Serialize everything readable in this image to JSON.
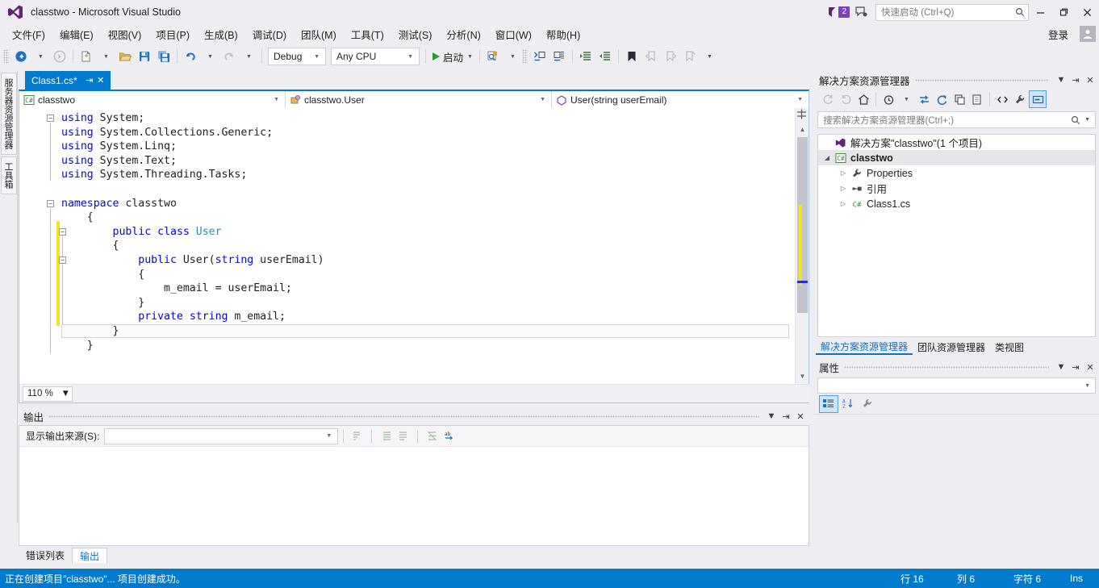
{
  "window": {
    "title": "classtwo - Microsoft Visual Studio",
    "logo_icon": "visual-studio-logo-icon",
    "notification_count": "2",
    "feedback_icon": "feedback-icon",
    "minimize_icon": "minimize-icon",
    "maximize_icon": "maximize-icon",
    "close_icon": "close-icon",
    "sign_in_label": "登录",
    "avatar_icon": "user-avatar-icon"
  },
  "quick_launch": {
    "placeholder": "快速启动 (Ctrl+Q)",
    "search_icon": "search-icon"
  },
  "menu": {
    "items": [
      {
        "label": "文件(F)"
      },
      {
        "label": "编辑(E)"
      },
      {
        "label": "视图(V)"
      },
      {
        "label": "项目(P)"
      },
      {
        "label": "生成(B)"
      },
      {
        "label": "调试(D)"
      },
      {
        "label": "团队(M)"
      },
      {
        "label": "工具(T)"
      },
      {
        "label": "测试(S)"
      },
      {
        "label": "分析(N)"
      },
      {
        "label": "窗口(W)"
      },
      {
        "label": "帮助(H)"
      }
    ]
  },
  "toolbar": {
    "navigate_back_icon": "navigate-back-icon",
    "navigate_forward_icon": "navigate-forward-icon",
    "new_project_icon": "new-project-icon",
    "open_file_icon": "open-file-icon",
    "save_icon": "save-icon",
    "save_all_icon": "save-all-icon",
    "undo_icon": "undo-icon",
    "redo_icon": "redo-icon",
    "config_value": "Debug",
    "platform_value": "Any CPU",
    "start_label": "启动",
    "start_icon": "play-icon",
    "find_icon": "find-in-files-icon",
    "comment_icon": "comment-selection-icon",
    "uncomment_icon": "uncomment-selection-icon",
    "indent_icon": "increase-indent-icon",
    "outdent_icon": "decrease-indent-icon",
    "bookmark_icon": "bookmark-icon",
    "prev_bookmark_icon": "previous-bookmark-icon",
    "next_bookmark_icon": "next-bookmark-icon",
    "clear_bookmarks_icon": "clear-bookmarks-icon",
    "overflow_icon": "toolbar-overflow-icon"
  },
  "autohide_tabs": [
    {
      "label": "服务器资源管理器",
      "icon": "server-explorer-icon"
    },
    {
      "label": "工具箱",
      "icon": "toolbox-icon"
    }
  ],
  "editor": {
    "tab": {
      "label": "Class1.cs*",
      "pin_icon": "pin-icon",
      "close_icon": "close-icon"
    },
    "nav_project": {
      "value": "classtwo",
      "icon": "csharp-file-icon"
    },
    "nav_type": {
      "value": "classtwo.User",
      "icon": "class-icon"
    },
    "nav_member": {
      "value": "User(string userEmail)",
      "icon": "method-icon"
    },
    "zoom_level": "110 %",
    "split_icon": "split-view-icon",
    "scroll_up_icon": "scroll-up-icon",
    "scroll_down_icon": "scroll-down-icon",
    "code_lines": [
      {
        "indent": 0,
        "tokens": [
          {
            "t": "using",
            "c": "k"
          },
          {
            "t": " System;",
            "c": ""
          }
        ]
      },
      {
        "indent": 0,
        "tokens": [
          {
            "t": "using",
            "c": "k"
          },
          {
            "t": " System.Collections.Generic;",
            "c": ""
          }
        ]
      },
      {
        "indent": 0,
        "tokens": [
          {
            "t": "using",
            "c": "k"
          },
          {
            "t": " System.Linq;",
            "c": ""
          }
        ]
      },
      {
        "indent": 0,
        "tokens": [
          {
            "t": "using",
            "c": "k"
          },
          {
            "t": " System.Text;",
            "c": ""
          }
        ]
      },
      {
        "indent": 0,
        "tokens": [
          {
            "t": "using",
            "c": "k"
          },
          {
            "t": " System.Threading.Tasks;",
            "c": ""
          }
        ]
      },
      {
        "indent": 0,
        "tokens": []
      },
      {
        "indent": 0,
        "tokens": [
          {
            "t": "namespace",
            "c": "k"
          },
          {
            "t": " classtwo",
            "c": ""
          }
        ]
      },
      {
        "indent": 1,
        "tokens": [
          {
            "t": "{",
            "c": ""
          }
        ]
      },
      {
        "indent": 2,
        "tokens": [
          {
            "t": "public",
            "c": "k"
          },
          {
            "t": " ",
            "c": ""
          },
          {
            "t": "class",
            "c": "k"
          },
          {
            "t": " ",
            "c": ""
          },
          {
            "t": "User",
            "c": "t"
          }
        ]
      },
      {
        "indent": 2,
        "tokens": [
          {
            "t": "{",
            "c": ""
          }
        ]
      },
      {
        "indent": 3,
        "tokens": [
          {
            "t": "public",
            "c": "k"
          },
          {
            "t": " User(",
            "c": ""
          },
          {
            "t": "string",
            "c": "k"
          },
          {
            "t": " userEmail)",
            "c": ""
          }
        ]
      },
      {
        "indent": 3,
        "tokens": [
          {
            "t": "{",
            "c": ""
          }
        ]
      },
      {
        "indent": 4,
        "tokens": [
          {
            "t": "m_email = userEmail;",
            "c": ""
          }
        ]
      },
      {
        "indent": 3,
        "tokens": [
          {
            "t": "}",
            "c": ""
          }
        ]
      },
      {
        "indent": 3,
        "tokens": [
          {
            "t": "private",
            "c": "k"
          },
          {
            "t": " ",
            "c": ""
          },
          {
            "t": "string",
            "c": "k"
          },
          {
            "t": " m_email;",
            "c": ""
          }
        ]
      },
      {
        "indent": 2,
        "tokens": [
          {
            "t": "}",
            "c": ""
          }
        ]
      },
      {
        "indent": 1,
        "tokens": [
          {
            "t": "}",
            "c": ""
          }
        ]
      }
    ]
  },
  "output_panel": {
    "title": "输出",
    "dropdown_icon": "chevron-down-icon",
    "pin_icon": "pin-icon",
    "close_icon": "close-icon",
    "source_label": "显示输出来源(S):",
    "source_value": "",
    "content": "",
    "icons": [
      {
        "name": "find-message-icon"
      },
      {
        "name": "clear-all-icon"
      },
      {
        "name": "toggle-word-wrap-icon"
      },
      {
        "name": "go-to-message-icon"
      },
      {
        "name": "toggle-autoscroll-icon"
      }
    ]
  },
  "bottom_tabs": [
    {
      "label": "错误列表",
      "active": false
    },
    {
      "label": "输出",
      "active": true
    }
  ],
  "solution_explorer": {
    "title": "解决方案资源管理器",
    "dropdown_icon": "chevron-down-icon",
    "pin_icon": "pin-icon",
    "close_icon": "close-icon",
    "search_placeholder": "搜索解决方案资源管理器(Ctrl+;)",
    "search_icon": "search-icon",
    "search_dropdown_icon": "chevron-down-icon",
    "toolbar_icons": [
      {
        "name": "back-icon",
        "state": "dim"
      },
      {
        "name": "forward-icon",
        "state": "dim"
      },
      {
        "name": "home-icon",
        "state": "normal"
      },
      {
        "name": "pending-changes-icon",
        "state": "normal"
      },
      {
        "name": "sync-with-active-document-icon",
        "state": "normal"
      },
      {
        "name": "refresh-icon",
        "state": "normal"
      },
      {
        "name": "collapse-all-icon",
        "state": "normal"
      },
      {
        "name": "show-all-files-icon",
        "state": "normal"
      },
      {
        "name": "view-code-icon",
        "state": "normal"
      },
      {
        "name": "properties-icon",
        "state": "normal"
      },
      {
        "name": "preview-selected-items-icon",
        "state": "selected"
      }
    ],
    "tree": [
      {
        "label": "解决方案\"classtwo\"(1 个项目)",
        "icon": "solution-icon",
        "depth": 0,
        "expander": "",
        "bold": false,
        "selected": false
      },
      {
        "label": "classtwo",
        "icon": "csharp-project-icon",
        "depth": 0,
        "expander": "expanded",
        "bold": true,
        "selected": true
      },
      {
        "label": "Properties",
        "icon": "properties-folder-icon",
        "depth": 1,
        "expander": "collapsed",
        "bold": false,
        "selected": false
      },
      {
        "label": "引用",
        "icon": "references-icon",
        "depth": 1,
        "expander": "collapsed",
        "bold": false,
        "selected": false
      },
      {
        "label": "Class1.cs",
        "icon": "csharp-file-icon",
        "depth": 1,
        "expander": "collapsed",
        "bold": false,
        "selected": false
      }
    ],
    "tabs": [
      {
        "label": "解决方案资源管理器",
        "active": true
      },
      {
        "label": "团队资源管理器",
        "active": false
      },
      {
        "label": "类视图",
        "active": false
      }
    ]
  },
  "properties_panel": {
    "title": "属性",
    "dropdown_icon": "chevron-down-icon",
    "pin_icon": "pin-icon",
    "close_icon": "close-icon",
    "object_value": "",
    "object_dropdown_icon": "chevron-down-icon",
    "categorized_icon": "categorized-view-icon",
    "alphabetical_icon": "alphabetical-sort-icon",
    "property_pages_icon": "property-pages-icon"
  },
  "status_bar": {
    "message": "正在创建项目\"classtwo\"... 项目创建成功。",
    "line_label": "行 16",
    "column_label": "列 6",
    "char_label": "字符 6",
    "insert_mode": "Ins",
    "background": "#007acc"
  },
  "colors": {
    "accent": "#007acc",
    "keyword": "#0000ff",
    "type": "#2b91af",
    "badge": "#7d3fbf",
    "change_bar": "#f2e32a",
    "chrome": "#eeeef2"
  }
}
